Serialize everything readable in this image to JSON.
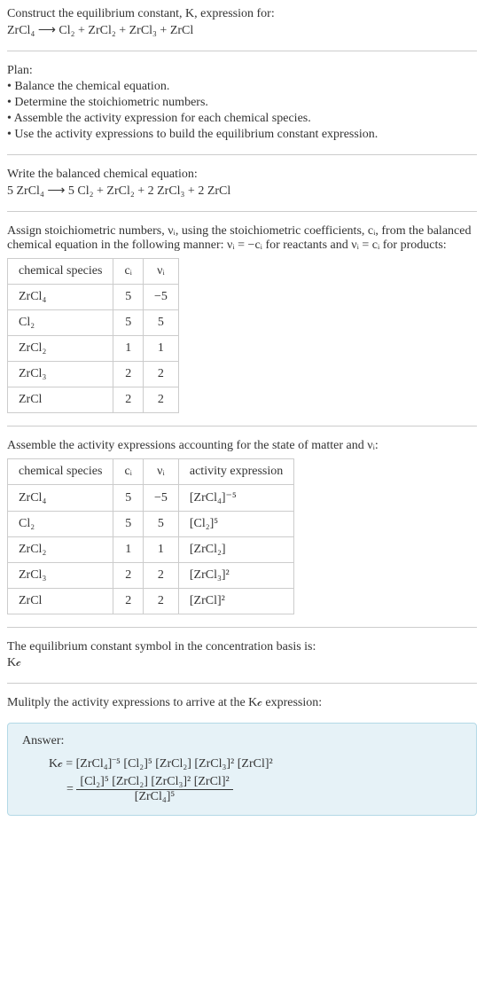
{
  "intro": {
    "line1": "Construct the equilibrium constant, K, expression for:",
    "equation": "ZrCl₄ ⟶ Cl₂ + ZrCl₂ + ZrCl₃ + ZrCl"
  },
  "plan": {
    "header": "Plan:",
    "step1": "• Balance the chemical equation.",
    "step2": "• Determine the stoichiometric numbers.",
    "step3": "• Assemble the activity expression for each chemical species.",
    "step4": "• Use the activity expressions to build the equilibrium constant expression."
  },
  "balanced": {
    "header": "Write the balanced chemical equation:",
    "equation": "5 ZrCl₄ ⟶ 5 Cl₂ + ZrCl₂ + 2 ZrCl₃ + 2 ZrCl"
  },
  "stoich": {
    "header": "Assign stoichiometric numbers, νᵢ, using the stoichiometric coefficients, cᵢ, from the balanced chemical equation in the following manner: νᵢ = −cᵢ for reactants and νᵢ = cᵢ for products:",
    "headers": {
      "species": "chemical species",
      "ci": "cᵢ",
      "vi": "νᵢ"
    },
    "rows": [
      {
        "species": "ZrCl₄",
        "ci": "5",
        "vi": "−5"
      },
      {
        "species": "Cl₂",
        "ci": "5",
        "vi": "5"
      },
      {
        "species": "ZrCl₂",
        "ci": "1",
        "vi": "1"
      },
      {
        "species": "ZrCl₃",
        "ci": "2",
        "vi": "2"
      },
      {
        "species": "ZrCl",
        "ci": "2",
        "vi": "2"
      }
    ]
  },
  "activity": {
    "header": "Assemble the activity expressions accounting for the state of matter and νᵢ:",
    "headers": {
      "species": "chemical species",
      "ci": "cᵢ",
      "vi": "νᵢ",
      "expr": "activity expression"
    },
    "rows": [
      {
        "species": "ZrCl₄",
        "ci": "5",
        "vi": "−5",
        "expr": "[ZrCl₄]⁻⁵"
      },
      {
        "species": "Cl₂",
        "ci": "5",
        "vi": "5",
        "expr": "[Cl₂]⁵"
      },
      {
        "species": "ZrCl₂",
        "ci": "1",
        "vi": "1",
        "expr": "[ZrCl₂]"
      },
      {
        "species": "ZrCl₃",
        "ci": "2",
        "vi": "2",
        "expr": "[ZrCl₃]²"
      },
      {
        "species": "ZrCl",
        "ci": "2",
        "vi": "2",
        "expr": "[ZrCl]²"
      }
    ]
  },
  "symbol": {
    "line1": "The equilibrium constant symbol in the concentration basis is:",
    "line2": "K𝒸"
  },
  "multiply": {
    "header": "Mulitply the activity expressions to arrive at the K𝒸 expression:"
  },
  "answer": {
    "label": "Answer:",
    "line1": "K𝒸 = [ZrCl₄]⁻⁵ [Cl₂]⁵ [ZrCl₂] [ZrCl₃]² [ZrCl]²",
    "numerator": "[Cl₂]⁵ [ZrCl₂] [ZrCl₃]² [ZrCl]²",
    "denominator": "[ZrCl₄]⁵",
    "eq": "= "
  },
  "chart_data": {
    "type": "table",
    "tables": [
      {
        "title": "Stoichiometric numbers",
        "columns": [
          "chemical species",
          "cᵢ",
          "νᵢ"
        ],
        "rows": [
          [
            "ZrCl₄",
            5,
            -5
          ],
          [
            "Cl₂",
            5,
            5
          ],
          [
            "ZrCl₂",
            1,
            1
          ],
          [
            "ZrCl₃",
            2,
            2
          ],
          [
            "ZrCl",
            2,
            2
          ]
        ]
      },
      {
        "title": "Activity expressions",
        "columns": [
          "chemical species",
          "cᵢ",
          "νᵢ",
          "activity expression"
        ],
        "rows": [
          [
            "ZrCl₄",
            5,
            -5,
            "[ZrCl₄]⁻⁵"
          ],
          [
            "Cl₂",
            5,
            5,
            "[Cl₂]⁵"
          ],
          [
            "ZrCl₂",
            1,
            1,
            "[ZrCl₂]"
          ],
          [
            "ZrCl₃",
            2,
            2,
            "[ZrCl₃]²"
          ],
          [
            "ZrCl",
            2,
            2,
            "[ZrCl]²"
          ]
        ]
      }
    ]
  }
}
